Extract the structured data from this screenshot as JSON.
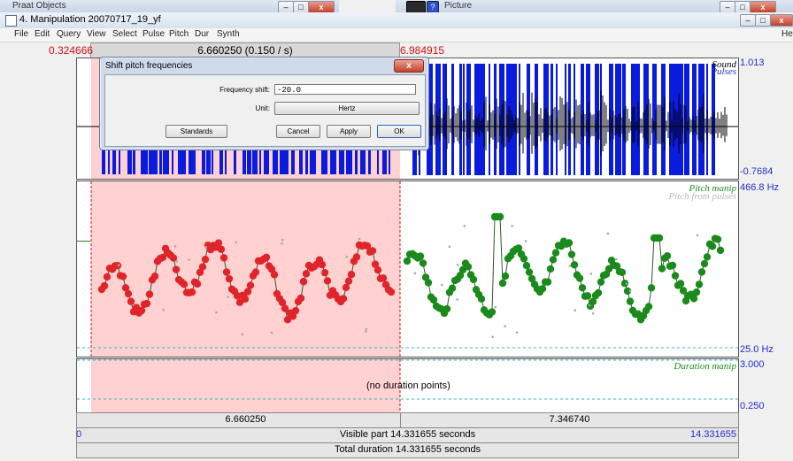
{
  "background_windows": {
    "left_title": "Praat Objects",
    "right_title": "Picture"
  },
  "window": {
    "title": "4. Manipulation 20070717_19_yf",
    "help_label": "Hel"
  },
  "menu": [
    "File",
    "Edit",
    "Query",
    "View",
    "Select",
    "Pulse",
    "Pitch",
    "Dur",
    "Synth"
  ],
  "selection": {
    "start": "0.324666",
    "length_label": "6.660250 (0.150 / s)",
    "end": "6.984915"
  },
  "sound_panel": {
    "label_sound": "Sound",
    "label_pulses": "Pulses",
    "max": "1.013",
    "min": "-0.7684"
  },
  "pitch_panel": {
    "label_manip": "Pitch manip",
    "label_from_pulses": "Pitch from pulses",
    "max": "466.8 Hz",
    "min": "25.0 Hz",
    "selected_color": "#e0242a",
    "unselected_color": "#1a8a1a"
  },
  "duration_panel": {
    "label": "Duration manip",
    "max": "3.000",
    "min": "0.250",
    "message": "(no duration points)"
  },
  "time_bar": {
    "selection_length": "6.660250",
    "rest_length": "7.346740"
  },
  "visible_bar": {
    "left": "0",
    "text": "Visible part 14.331655 seconds",
    "right": "14.331655"
  },
  "total_bar": {
    "text": "Total duration 14.331655 seconds"
  },
  "dialog": {
    "title": "Shift pitch frequencies",
    "close": "x",
    "freq_label": "Frequency shift:",
    "freq_value": "-20.0",
    "unit_label": "Unit:",
    "unit_value": "Hertz",
    "buttons": {
      "standards": "Standards",
      "cancel": "Cancel",
      "apply": "Apply",
      "ok": "OK"
    }
  }
}
